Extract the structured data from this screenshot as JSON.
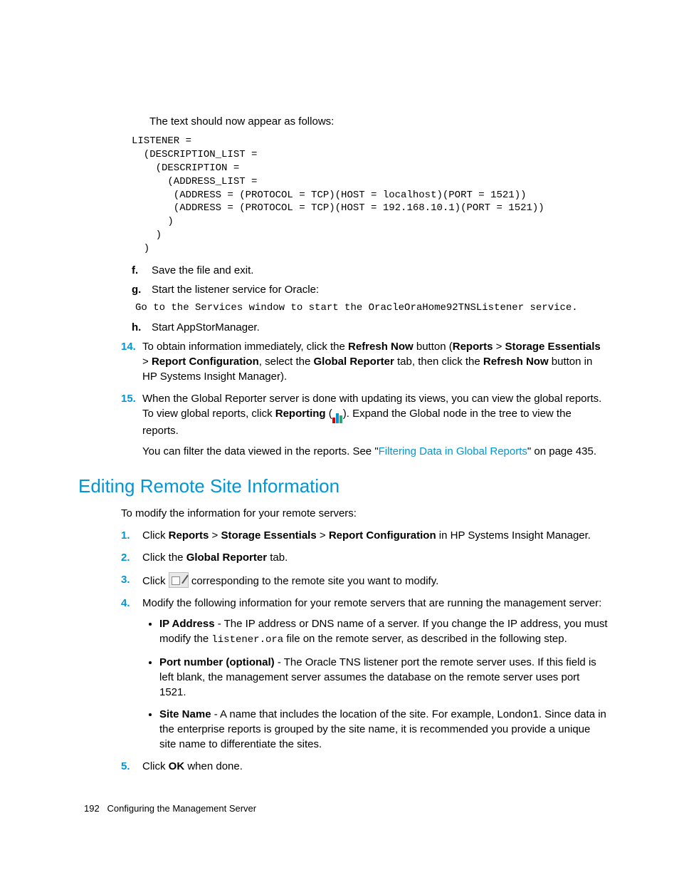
{
  "intro": "The text should now appear as follows:",
  "code_block": "LISTENER =\n  (DESCRIPTION_LIST =\n    (DESCRIPTION =\n      (ADDRESS_LIST =\n       (ADDRESS = (PROTOCOL = TCP)(HOST = localhost)(PORT = 1521))\n       (ADDRESS = (PROTOCOL = TCP)(HOST = 192.168.10.1)(PORT = 1521))\n      )\n    )\n  )",
  "step_f": {
    "marker": "f.",
    "text": "Save the file and exit."
  },
  "step_g": {
    "marker": "g.",
    "text": "Start the listener service for Oracle:"
  },
  "g_code": "Go to the Services window to start the OracleOraHome92TNSListener service.",
  "step_h": {
    "marker": "h.",
    "text": "Start AppStorManager."
  },
  "step14": {
    "num": "14.",
    "pre": "To obtain information immediately, click the ",
    "b1": "Refresh Now",
    "mid1": " button (",
    "b2": "Reports",
    "gt1": " > ",
    "b3": "Storage Essentials",
    "gt2": " > ",
    "b4": "Report Configuration",
    "mid2": ", select the ",
    "b5": "Global Reporter",
    "mid3": " tab, then click the ",
    "b6": "Refresh Now",
    "end": " button in HP Systems Insight Manager)."
  },
  "step15": {
    "num": "15.",
    "line1a": "When the Global Reporter server is done with updating its views, you can view the global reports. To view global reports, click ",
    "b1": "Reporting",
    "paren_open": " (",
    "paren_close": "). Expand the Global node in the tree to view the reports.",
    "line2a": "You can filter the data viewed in the reports. See \"",
    "link": "Filtering Data in Global Reports",
    "line2b": "\" on page 435."
  },
  "section_title": "Editing Remote Site Information",
  "section_intro": "To modify the information for your remote servers:",
  "e1": {
    "num": "1.",
    "a": "Click ",
    "b1": "Reports",
    "gt1": " > ",
    "b2": "Storage Essentials",
    "gt2": " > ",
    "b3": "Report Configuration",
    "end": " in HP Systems Insight Manager."
  },
  "e2": {
    "num": "2.",
    "a": "Click the ",
    "b1": "Global Reporter",
    "end": " tab."
  },
  "e3": {
    "num": "3.",
    "a": "Click ",
    "end": " corresponding to the remote site you want to modify."
  },
  "e4": {
    "num": "4.",
    "intro": "Modify the following information for your remote servers that are running the management server:",
    "bullets": {
      "ip": {
        "b": "IP Address",
        "t1": " - The IP address or DNS name of a server. If you change the IP address, you must modify the ",
        "code": "listener.ora",
        "t2": " file on the remote server, as described in the following step."
      },
      "port": {
        "b": "Port number (optional)",
        "t": " - The Oracle TNS listener port the remote server uses. If this field is left blank, the management server assumes the database on the remote server uses port 1521."
      },
      "site": {
        "b": "Site Name",
        "t": " - A name that includes the location of the site. For example, London1. Since data in the enterprise reports is grouped by the site name, it is recommended you provide a unique site name to differentiate the sites."
      }
    }
  },
  "e5": {
    "num": "5.",
    "a": "Click ",
    "b": "OK",
    "end": " when done."
  },
  "footer": {
    "page": "192",
    "title": "Configuring the Management Server"
  }
}
